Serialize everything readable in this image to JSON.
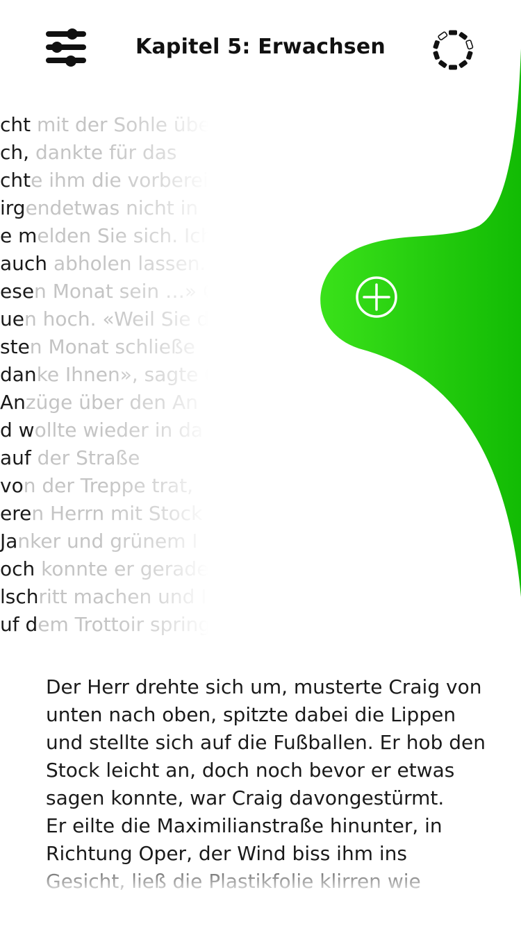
{
  "header": {
    "chapter_title": "Kapitel 5: Erwachsen",
    "settings_icon": "sliders-icon",
    "progress_icon": "progress-ring-icon"
  },
  "panel": {
    "color_start": "#3ae11a",
    "color_end": "#12bb04",
    "add_icon": "plus-circle-icon"
  },
  "scrolling_text": [
    {
      "lead": "cht",
      "tail": " mit der Sohle übe"
    },
    {
      "lead": "ch,",
      "tail": " dankte für das"
    },
    {
      "lead": "cht",
      "tail": "e ihm die vorberei"
    },
    {
      "lead": " irg",
      "tail": "endetwas nicht in"
    },
    {
      "lead": "e m",
      "tail": "elden Sie sich. Ich"
    },
    {
      "lead": "auch",
      "tail": " abholen lassen. I"
    },
    {
      "lead": "ese",
      "tail": "n Monat sein …» C"
    },
    {
      "lead": "ue",
      "tail": "n hoch. «Weil Sie d"
    },
    {
      "lead": "ste",
      "tail": "n Monat schließe"
    },
    {
      "lead": "dan",
      "tail": "ke Ihnen», sagte C"
    },
    {
      "lead": " An",
      "tail": "züge über den An"
    },
    {
      "lead": "d w",
      "tail": "ollte wieder in da"
    },
    {
      "lead": " auf",
      "tail": " der Straße"
    },
    {
      "lead": " vo",
      "tail": "n der Treppe trat,"
    },
    {
      "lead": "ere",
      "tail": "n Herrn mit Stock"
    },
    {
      "lead": " Ja",
      "tail": "nker und grünem I"
    },
    {
      "lead": "och",
      "tail": " konnte er gerade"
    },
    {
      "lead": "lsch",
      "tail": "ritt machen und I"
    },
    {
      "lead": "uf d",
      "tail": "em Trottoir spring"
    }
  ],
  "body_lines": [
    "Der Herr drehte sich um, musterte Craig von",
    "unten nach oben, spitzte dabei die Lippen",
    "und stellte sich auf die Fußballen. Er hob den",
    "Stock leicht an, doch noch bevor er etwas",
    "sagen konnte, war Craig davongestürmt.",
    "Er eilte die Maximilianstraße hinunter, in",
    "Richtung Oper, der Wind biss ihm ins",
    "Gesicht, ließ die Plastikfolie klirren wie"
  ]
}
